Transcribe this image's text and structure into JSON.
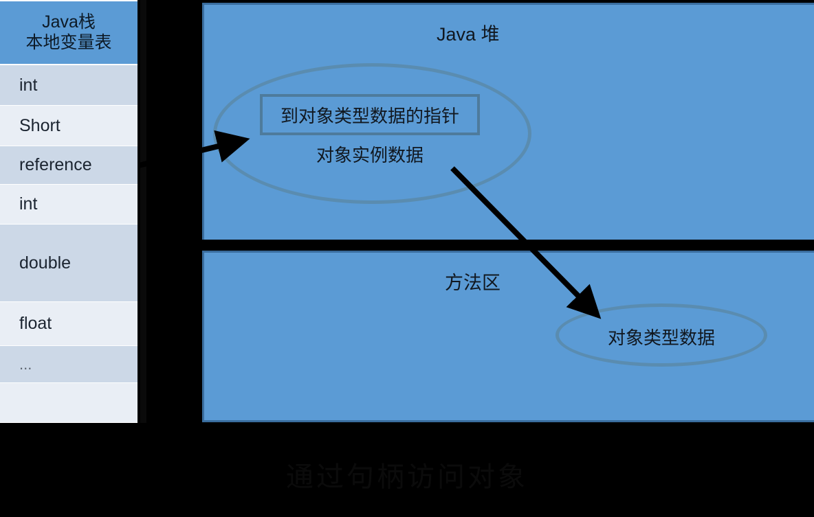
{
  "stack": {
    "header_line1": "Java栈",
    "header_line2": "本地变量表",
    "rows": [
      {
        "label": "int"
      },
      {
        "label": "Short"
      },
      {
        "label": "reference"
      },
      {
        "label": "int"
      },
      {
        "label": "double"
      },
      {
        "label": "float"
      },
      {
        "label": "..."
      },
      {
        "label": ""
      }
    ]
  },
  "heap": {
    "title": "Java 堆",
    "pointer_box_label": "到对象类型数据的指针",
    "instance_data_label": "对象实例数据"
  },
  "method_area": {
    "title": "方法区",
    "class_data_label": "对象类型数据"
  },
  "caption": "通过句柄访问对象",
  "colors": {
    "background": "#000000",
    "heap_fill": "#5b9bd5",
    "heap_border": "#3a6d9e",
    "stack_header_fill": "#5b9bd5",
    "row_dark": "#ccd8e7",
    "row_light": "#e9eef5",
    "ellipse_stroke": "#5a8cb0",
    "arrow": "#000000",
    "text": "#111820"
  }
}
